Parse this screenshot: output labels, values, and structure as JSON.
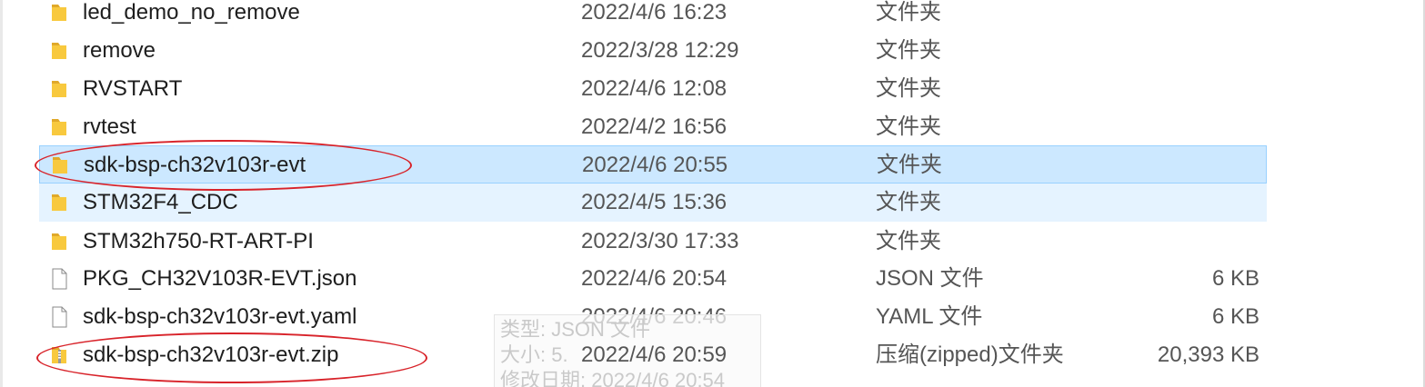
{
  "tooltip": {
    "type_line": "类型: JSON 文件",
    "size_line": "大小: 5.",
    "modified_line": "修改日期: 2022/4/6 20:54"
  },
  "files": [
    {
      "name": "led_demo_no_remove",
      "date": "2022/4/6 16:23",
      "type": "文件夹",
      "size": "",
      "icon": "folder-icon"
    },
    {
      "name": "remove",
      "date": "2022/3/28 12:29",
      "type": "文件夹",
      "size": "",
      "icon": "folder-icon"
    },
    {
      "name": "RVSTART",
      "date": "2022/4/6 12:08",
      "type": "文件夹",
      "size": "",
      "icon": "folder-icon"
    },
    {
      "name": "rvtest",
      "date": "2022/4/2 16:56",
      "type": "文件夹",
      "size": "",
      "icon": "folder-icon"
    },
    {
      "name": "sdk-bsp-ch32v103r-evt",
      "date": "2022/4/6 20:55",
      "type": "文件夹",
      "size": "",
      "icon": "folder-icon"
    },
    {
      "name": "STM32F4_CDC",
      "date": "2022/4/5 15:36",
      "type": "文件夹",
      "size": "",
      "icon": "folder-icon"
    },
    {
      "name": "STM32h750-RT-ART-PI",
      "date": "2022/3/30 17:33",
      "type": "文件夹",
      "size": "",
      "icon": "folder-icon"
    },
    {
      "name": "PKG_CH32V103R-EVT.json",
      "date": "2022/4/6 20:54",
      "type": "JSON 文件",
      "size": "6 KB",
      "icon": "file-icon"
    },
    {
      "name": "sdk-bsp-ch32v103r-evt.yaml",
      "date": "2022/4/6 20:46",
      "type": "YAML 文件",
      "size": "6 KB",
      "icon": "file-icon"
    },
    {
      "name": "sdk-bsp-ch32v103r-evt.zip",
      "date": "2022/4/6 20:59",
      "type": "压缩(zipped)文件夹",
      "size": "20,393 KB",
      "icon": "zip-folder-icon"
    }
  ],
  "colors": {
    "selected_bg": "#cce8ff",
    "selected_border": "#99d1ff",
    "hover_bg": "#e5f3ff",
    "annotation": "#d8232a",
    "folder": "#f8c93e"
  }
}
